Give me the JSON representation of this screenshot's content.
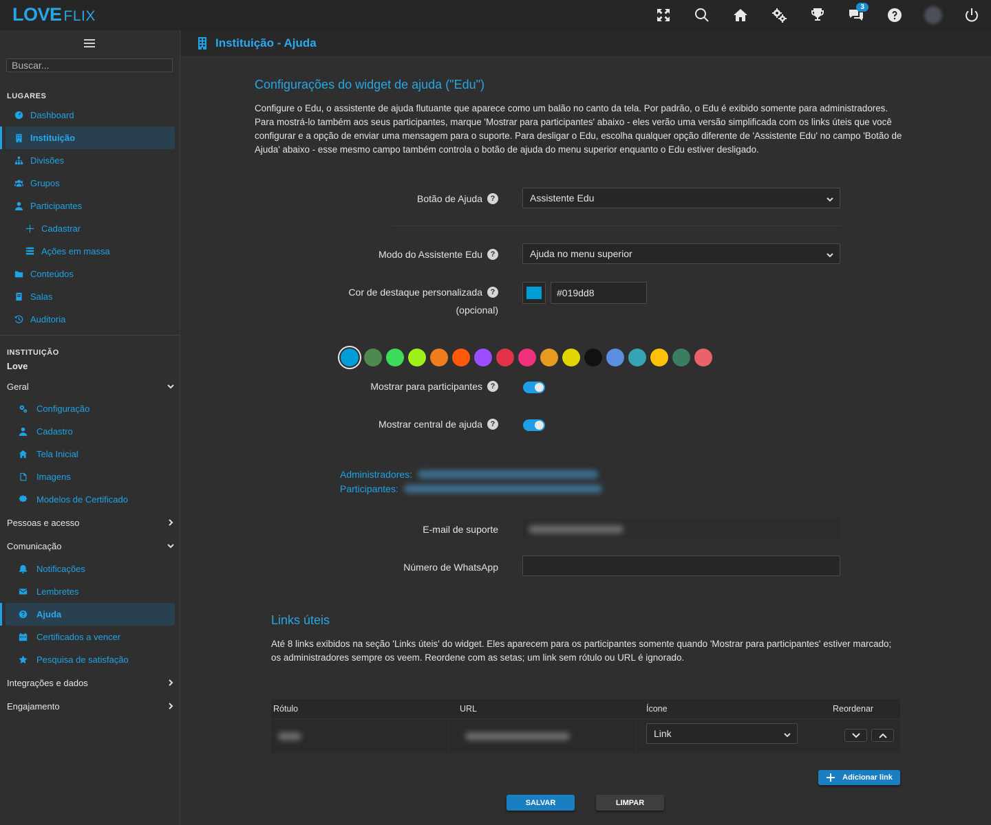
{
  "app": {
    "logo_main": "LOVE",
    "logo_sub": "FLIX"
  },
  "topbar": {
    "icons": [
      "expand-icon",
      "search-icon",
      "home-icon",
      "gears-icon",
      "trophy-icon",
      "chat-icon",
      "help-icon",
      "avatar",
      "power-icon"
    ],
    "chat_badge": "3",
    "accent": "#1fa3e6"
  },
  "sidebar": {
    "search_placeholder": "Buscar...",
    "places_title": "LUGARES",
    "places": [
      {
        "label": "Dashboard",
        "icon": "dashboard-icon"
      },
      {
        "label": "Instituição",
        "icon": "building-icon",
        "active": true
      },
      {
        "label": "Divisões",
        "icon": "sitemap-icon"
      },
      {
        "label": "Grupos",
        "icon": "users-icon"
      },
      {
        "label": "Participantes",
        "icon": "user-icon"
      },
      {
        "label": "Cadastrar",
        "icon": "plus-icon"
      },
      {
        "label": "Ações em massa",
        "icon": "tasks-icon"
      },
      {
        "label": "Conteúdos",
        "icon": "folder-icon"
      },
      {
        "label": "Salas",
        "icon": "book-icon"
      },
      {
        "label": "Auditoria",
        "icon": "history-icon"
      }
    ],
    "inst_title": "INSTITUIÇÃO",
    "inst_name": "Love",
    "groups": {
      "geral": "Geral",
      "pessoas": "Pessoas e acesso",
      "comunicacao": "Comunicação",
      "integracoes": "Integrações e dados",
      "engajamento": "Engajamento"
    },
    "geral_items": [
      {
        "label": "Configuração",
        "icon": "gears-icon"
      },
      {
        "label": "Cadastro",
        "icon": "user-icon"
      },
      {
        "label": "Tela Inicial",
        "icon": "home-icon"
      },
      {
        "label": "Imagens",
        "icon": "file-icon"
      },
      {
        "label": "Modelos de Certificado",
        "icon": "certificate-icon"
      }
    ],
    "com_items": [
      {
        "label": "Notificações",
        "icon": "bell-icon"
      },
      {
        "label": "Lembretes",
        "icon": "envelope-icon"
      },
      {
        "label": "Ajuda",
        "icon": "question-icon",
        "active": true
      },
      {
        "label": "Certificados a vencer",
        "icon": "calendar-icon"
      },
      {
        "label": "Pesquisa de satisfação",
        "icon": "star-icon"
      }
    ]
  },
  "header": {
    "title": "Instituição - Ajuda"
  },
  "main": {
    "section_title": "Configurações do widget de ajuda (\"Edu\")",
    "intro": "Configure o Edu, o assistente de ajuda flutuante que aparece como um balão no canto da tela. Por padrão, o Edu é exibido somente para administradores. Para mostrá-lo também aos seus participantes, marque 'Mostrar para participantes' abaixo - eles verão uma versão simplificada com os links úteis que você configurar e a opção de enviar uma mensagem para o suporte. Para desligar o Edu, escolha qualquer opção diferente de 'Assistente Edu' no campo 'Botão de Ajuda' abaixo - esse mesmo campo também controla o botão de ajuda do menu superior enquanto o Edu estiver desligado.",
    "help_button_label": "Botão de Ajuda",
    "help_button_value": "Assistente Edu",
    "mode_label": "Modo do Assistente Edu",
    "mode_value": "Ajuda no menu superior",
    "color_label": "Cor de destaque personalizada",
    "color_optional": "(opcional)",
    "color_value": "#019dd8",
    "palette": [
      "#019dd8",
      "#4e8a4e",
      "#3ddc5a",
      "#9ef01a",
      "#f07d1e",
      "#ff5a0a",
      "#9b4dff",
      "#e0334a",
      "#f0317d",
      "#e69a20",
      "#e3d500",
      "#111111",
      "#5b8ee0",
      "#34a3b5",
      "#ffc107",
      "#3a7d5f",
      "#e8646a"
    ],
    "show_participants_label": "Mostrar para participantes",
    "show_center_label": "Mostrar central de ajuda",
    "admins_label": "Administradores:",
    "participants_label": "Participantes:",
    "email_label": "E-mail de suporte",
    "whatsapp_label": "Número de WhatsApp",
    "links_title": "Links úteis",
    "links_intro": "Até 8 links exibidos na seção 'Links úteis' do widget. Eles aparecem para os participantes somente quando 'Mostrar para participantes' estiver marcado; os administradores sempre os veem. Reordene com as setas; um link sem rótulo ou URL é ignorado.",
    "table_headers": [
      "Rótulo",
      "URL",
      "Ícone",
      "Reordenar"
    ],
    "row_icon_value": "Link",
    "add_link": "Adicionar link",
    "save": "SALVAR",
    "clear": "LIMPAR"
  }
}
